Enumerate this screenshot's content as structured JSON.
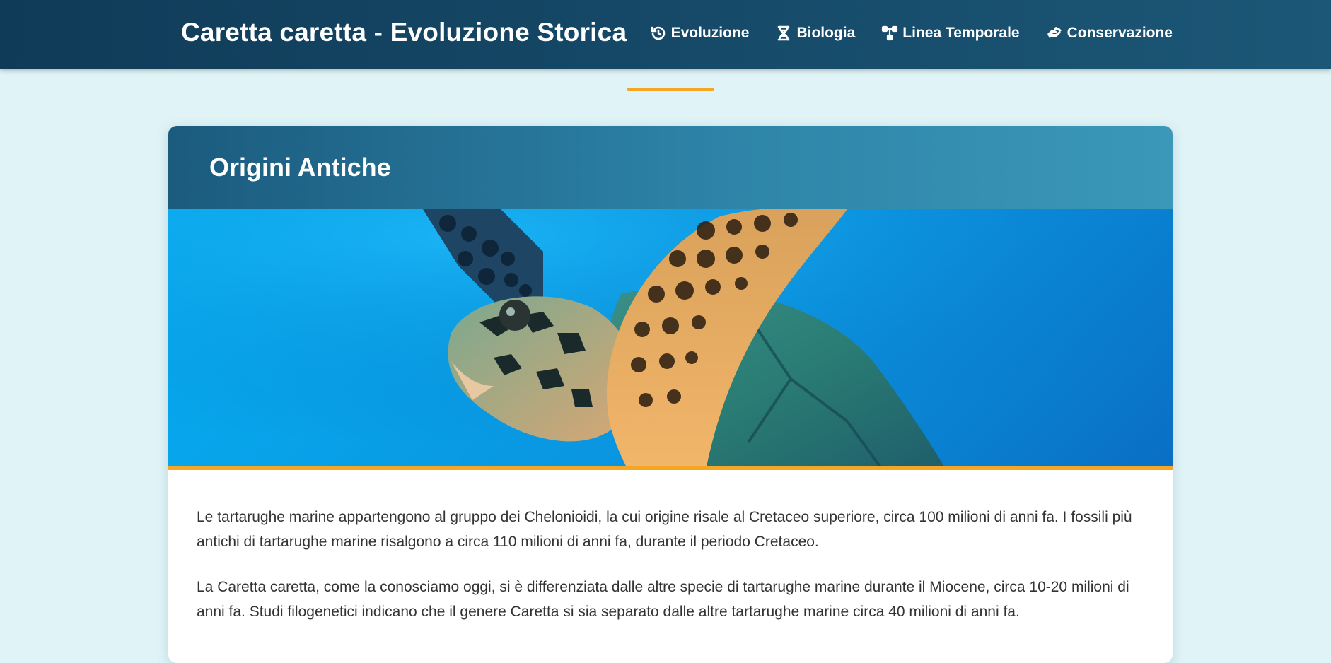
{
  "header": {
    "title": "Caretta caretta - Evoluzione Storica",
    "nav": [
      {
        "label": "Evoluzione",
        "icon": "history-icon"
      },
      {
        "label": "Biologia",
        "icon": "dna-icon"
      },
      {
        "label": "Linea Temporale",
        "icon": "timeline-icon"
      },
      {
        "label": "Conservazione",
        "icon": "hands-icon"
      }
    ]
  },
  "section": {
    "title": "Origini Antiche",
    "image": "sea-turtle-photo",
    "paragraphs": [
      "Le tartarughe marine appartengono al gruppo dei Chelonioidi, la cui origine risale al Cretaceo superiore, circa 100 milioni di anni fa. I fossili più antichi di tartarughe marine risalgono a circa 110 milioni di anni fa, durante il periodo Cretaceo.",
      "La Caretta caretta, come la conosciamo oggi, si è differenziata dalle altre specie di tartarughe marine durante il Miocene, circa 10-20 milioni di anni fa. Studi filogenetici indicano che il genere Caretta si sia separato dalle altre tartarughe marine circa 40 milioni di anni fa."
    ]
  },
  "colors": {
    "header_bg": "#0f3b58",
    "accent": "#f5a623",
    "page_bg": "#e0f4f7",
    "card_header": "#2d84a8"
  }
}
